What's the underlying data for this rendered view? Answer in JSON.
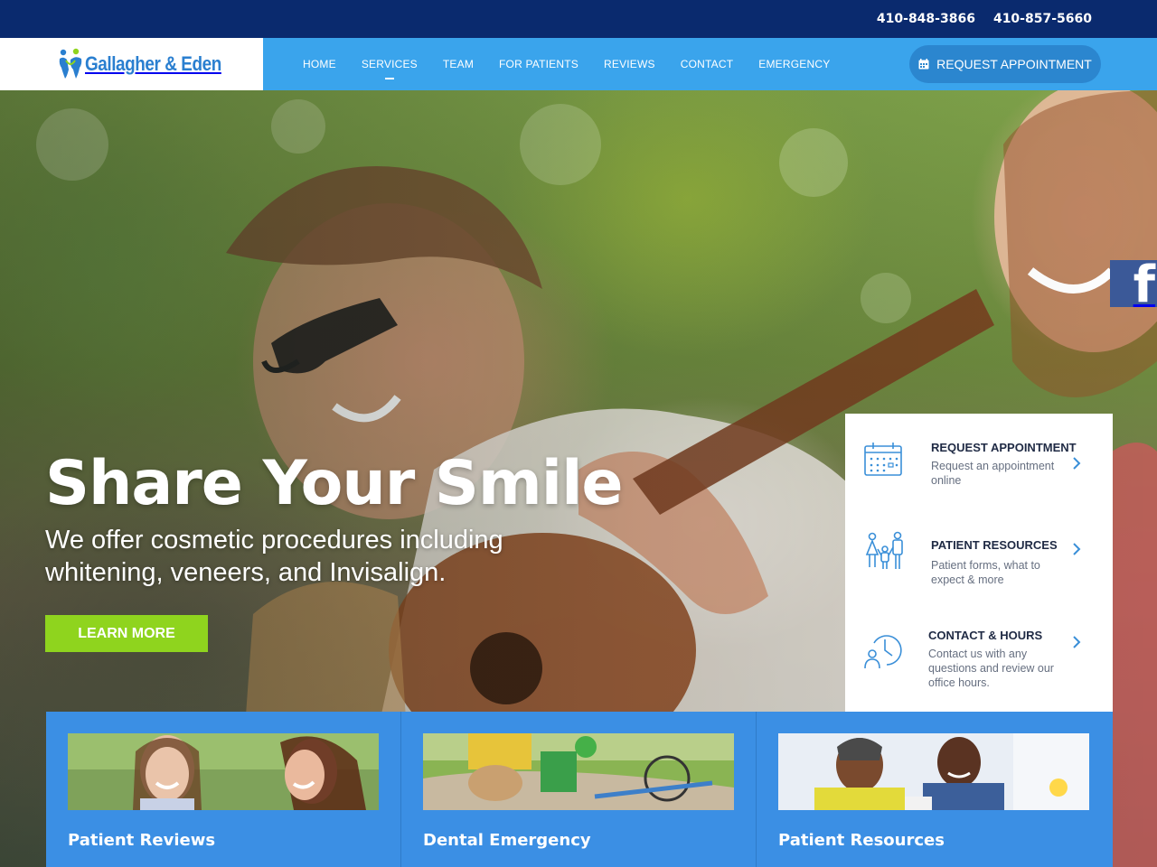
{
  "topbar": {
    "phones": [
      "410-848-3866",
      "410-857-5660"
    ]
  },
  "logo": {
    "text": "Gallagher & Eden",
    "icon": "tooth-family-logo-icon"
  },
  "nav": {
    "items": [
      {
        "label": "HOME"
      },
      {
        "label": "SERVICES"
      },
      {
        "label": "TEAM"
      },
      {
        "label": "FOR PATIENTS"
      },
      {
        "label": "REVIEWS"
      },
      {
        "label": "CONTACT"
      },
      {
        "label": "EMERGENCY"
      }
    ],
    "active": "SERVICES",
    "cta_label": "REQUEST APPOINTMENT",
    "cta_icon": "calendar-icon"
  },
  "hero": {
    "title": "Share Your Smile",
    "subtitle": "We offer cosmetic procedures including whitening, veneers, and Invisalign.",
    "button_label": "LEARN MORE"
  },
  "social": {
    "facebook_glyph": "f",
    "icon": "facebook-icon"
  },
  "quick_links": [
    {
      "title": "REQUEST APPOINTMENT",
      "desc": "Request an appointment online",
      "icon": "calendar-icon"
    },
    {
      "title": "PATIENT RESOURCES",
      "desc": "Patient forms, what to expect & more",
      "icon": "family-icon"
    },
    {
      "title": "CONTACT & HOURS",
      "desc": "Contact us with any questions and review our office hours.",
      "icon": "clock-person-icon"
    }
  ],
  "cards": [
    {
      "title": "Patient Reviews"
    },
    {
      "title": "Dental Emergency"
    },
    {
      "title": "Patient Resources"
    }
  ],
  "colors": {
    "topbar": "#0a2a6e",
    "navbar": "#3aa4ec",
    "cta": "#2b86cf",
    "learn_more": "#8fd41e",
    "cards": "#3b8fe4",
    "facebook": "#3b5998"
  }
}
